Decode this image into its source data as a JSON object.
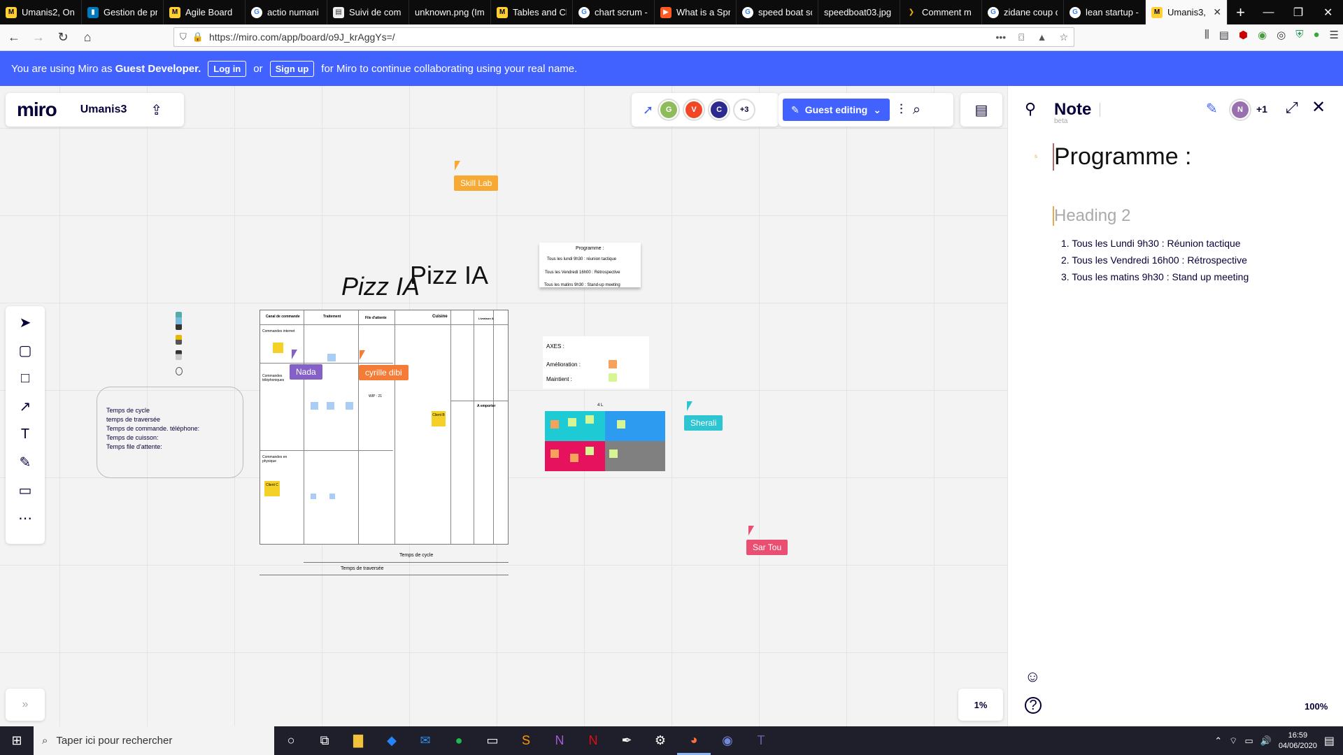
{
  "browser": {
    "tabs": [
      {
        "label": "Umanis2, On",
        "icon": "miro-icon",
        "fav": "miro"
      },
      {
        "label": "Gestion de pr",
        "icon": "trello-icon",
        "fav": "trello"
      },
      {
        "label": "Agile Board",
        "icon": "miro-icon",
        "fav": "miro"
      },
      {
        "label": "actio numani",
        "icon": "google-icon",
        "fav": "google"
      },
      {
        "label": "Suivi de com",
        "icon": "document-icon",
        "fav": "doc"
      },
      {
        "label": "unknown.png (Im",
        "icon": "",
        "fav": "none"
      },
      {
        "label": "Tables and Ch",
        "icon": "miro-icon",
        "fav": "miro"
      },
      {
        "label": "chart scrum -",
        "icon": "google-icon",
        "fav": "google"
      },
      {
        "label": "What is a Spr",
        "icon": "play-icon",
        "fav": "youtube"
      },
      {
        "label": "speed boat sc",
        "icon": "google-icon",
        "fav": "google"
      },
      {
        "label": "speedboat03.jpg",
        "icon": "",
        "fav": "none"
      },
      {
        "label": "Comment m",
        "icon": "comment-icon",
        "fav": "cmt"
      },
      {
        "label": "zidane coup c",
        "icon": "google-icon",
        "fav": "google"
      },
      {
        "label": "lean startup -",
        "icon": "google-icon",
        "fav": "google"
      }
    ],
    "active_tab": {
      "label": "Umanis3,",
      "close": "✕"
    },
    "new_tab": "+",
    "window_controls": {
      "minimize": "—",
      "maximize": "❐",
      "close": "✕"
    },
    "url": "https://miro.com/app/board/o9J_krAggYs=/",
    "url_more": "•••"
  },
  "banner": {
    "text_before": "You are using Miro as",
    "role": "Guest Developer.",
    "login": "Log in",
    "or": "or",
    "signup": "Sign up",
    "text_after": "for Miro to continue collaborating using your real name."
  },
  "miro": {
    "logo": "miro",
    "board_name": "Umanis3",
    "avatars": [
      {
        "letter": "G",
        "color": "#8fbc5a"
      },
      {
        "letter": "V",
        "color": "#f24726"
      },
      {
        "letter": "C",
        "color": "#2d2a8f"
      }
    ],
    "more_users": "+3",
    "guest_editing": "Guest editing",
    "zoom": "1%"
  },
  "board": {
    "cursors": [
      {
        "name": "Skill Lab",
        "color": "#f7a934"
      },
      {
        "name": "Nada",
        "color": "#8560c7"
      },
      {
        "name": "cyrille dibi",
        "color": "#f57c36"
      },
      {
        "name": "Sherali",
        "color": "#2ec5d3"
      },
      {
        "name": "Sar Tou",
        "color": "#ea4f72"
      }
    ],
    "title_left": "Pizz IA",
    "title_right": "Pizz IA",
    "programme_card": {
      "title": "Programme :",
      "items": [
        "Tous les lundi 9h30 : réunion tactique",
        "Tous les Vendredi 16h00 : Rétrospective",
        "Tous les matins 9h30 : Stand-up meeting"
      ]
    },
    "axes_card": {
      "title": "AXES :",
      "items": [
        {
          "label": "Amélioration :",
          "color": "#f7a25a"
        },
        {
          "label": "Maintient :",
          "color": "#d5f692"
        }
      ]
    },
    "metrics_card": [
      "Temps de cycle",
      "temps de traversée",
      "Temps de commande. téléphone:",
      "Temps de cuisson:",
      "Temps file d'attente:"
    ],
    "table_headers": [
      "Canal de commande",
      "Traitement",
      "File d'attente",
      "Cuisine",
      "Livraison &"
    ],
    "table_rows": [
      "Commandes internet",
      "Commandes téléphoniques",
      "Commandes en physique"
    ],
    "table_misc": {
      "a_emporter": "A emporter",
      "wip": "WIP : 21",
      "client_a": "Client A",
      "client_b": "Client B",
      "client_c": "Client C"
    },
    "footer_labels": [
      "Temps de cycle",
      "Temps de traversée"
    ],
    "matrix_label": "4 L"
  },
  "note": {
    "title": "Note",
    "beta": "beta",
    "avatar_letter": "N",
    "more": "+1",
    "h1": "Programme :",
    "h2": "Heading 2",
    "list": [
      "1.  Tous les Lundi 9h30 : Réunion tactique",
      "2.  Tous les Vendredi 16h00 : Rétrospective",
      "3.  Tous les matins 9h30 : Stand up meeting"
    ],
    "zoom": "100%"
  },
  "taskbar": {
    "search_placeholder": "Taper ici pour rechercher",
    "time": "16:59",
    "date": "04/06/2020"
  }
}
